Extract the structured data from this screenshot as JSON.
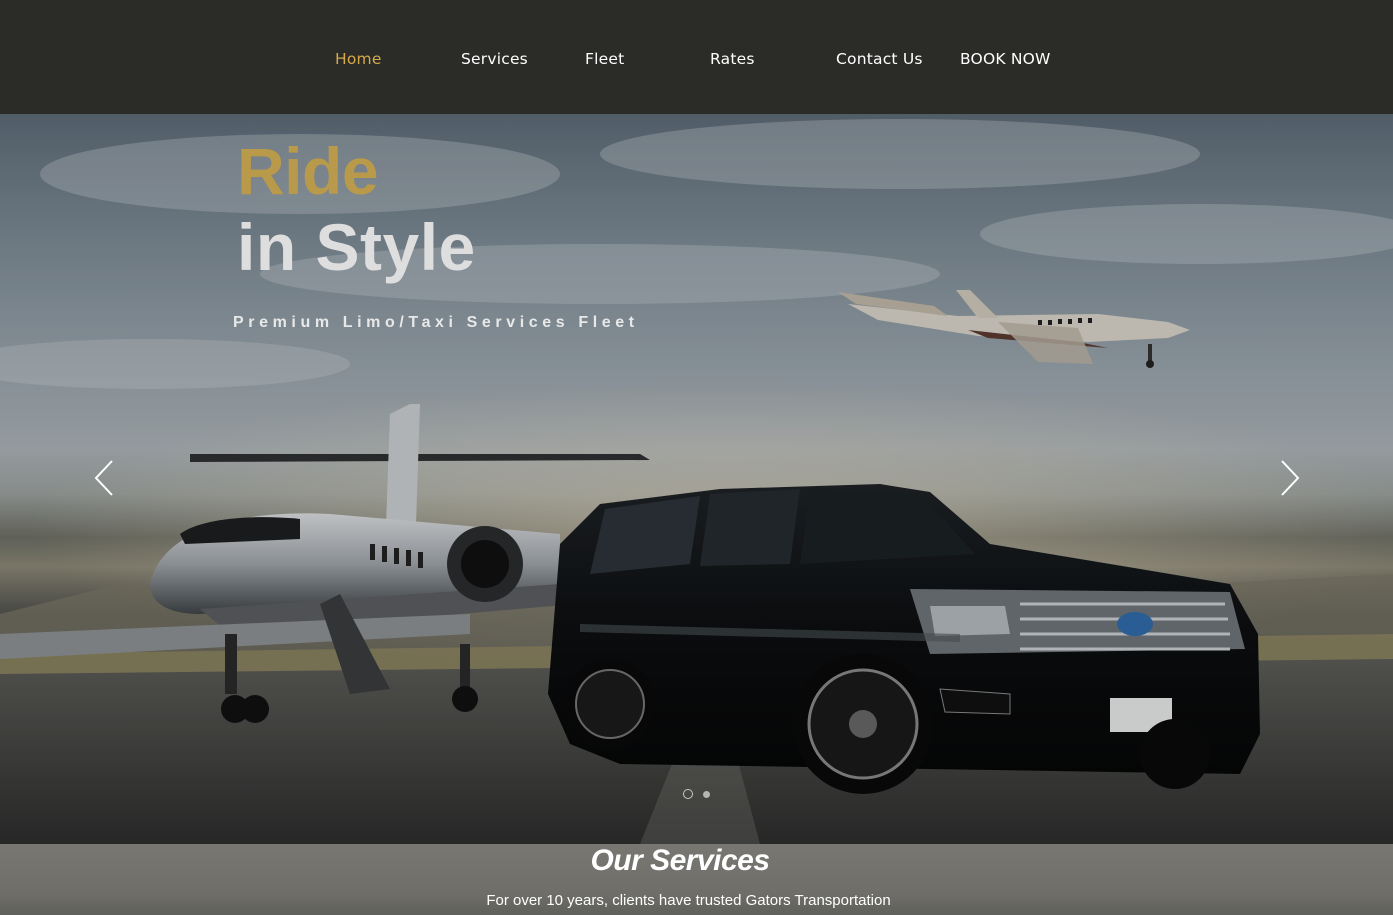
{
  "nav": {
    "home": "Home",
    "services": "Services",
    "fleet": "Fleet",
    "rates": "Rates",
    "contact": "Contact Us",
    "book": "BOOK NOW"
  },
  "hero": {
    "headline_1": "Ride",
    "headline_2": "in Style",
    "tagline": "Premium Limo/Taxi Services Fleet",
    "prev_icon": "chevron-left-icon",
    "next_icon": "chevron-right-icon",
    "slides_total": 2,
    "slide_active": 1
  },
  "services": {
    "title": "Our Services",
    "subtitle": "For over 10 years, clients have trusted Gators Transportation"
  },
  "colors": {
    "nav_bg": "#2b2c27",
    "accent_gold": "#d4a84b",
    "headline_gold": "#b99a4a"
  }
}
